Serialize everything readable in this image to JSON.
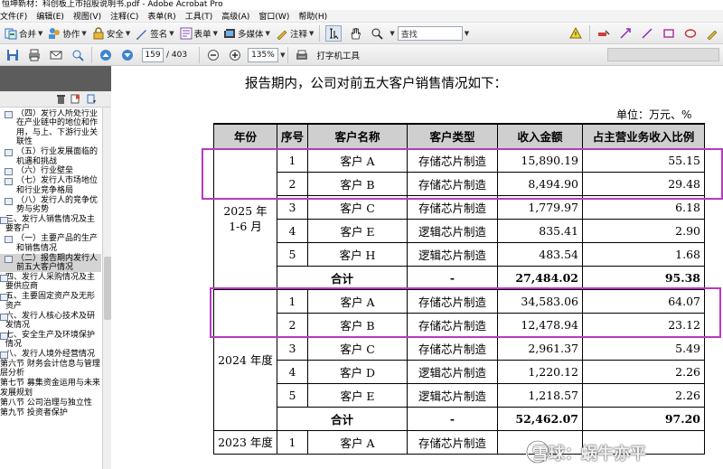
{
  "window": {
    "title": "恒坤新材：科创板上市招股说明书.pdf - Adobe Acrobat Pro"
  },
  "menu": [
    "文件(F)",
    "编辑(E)",
    "视图(V)",
    "注释(C)",
    "表单(R)",
    "工具(T)",
    "高级(A)",
    "窗口(W)",
    "帮助(H)"
  ],
  "toolbar1": {
    "merge": "合并",
    "collaborate": "协作",
    "secure": "安全",
    "sign": "签名",
    "forms": "表单",
    "multimedia": "多媒体",
    "comment": "注释",
    "search_placeholder": "查找"
  },
  "toolbar2": {
    "page_current": "159",
    "page_total": "/ 403",
    "zoom": "135%",
    "typewriter": "打字机工具"
  },
  "bookmarks": [
    {
      "label": "（四）发行人所处行业在产业链中的地位和作用，与上、下游行业关联性",
      "indent": 1
    },
    {
      "label": "（五）行业发展面临的机遇和挑战",
      "indent": 1
    },
    {
      "label": "（六）行业壁垒",
      "indent": 1
    },
    {
      "label": "（七）发行人市场地位和行业竞争格局",
      "indent": 1
    },
    {
      "label": "（八）发行人的竞争优势与劣势",
      "indent": 1
    },
    {
      "label": "三、发行人销售情况及主要客户",
      "indent": 0
    },
    {
      "label": "（一）主要产品的生产和销售情况",
      "indent": 1
    },
    {
      "label": "（二）报告期内发行人前五大客户情况",
      "indent": 1,
      "selected": true
    },
    {
      "label": "四、发行人采购情况及主要供应商",
      "indent": 0
    },
    {
      "label": "五、主要固定资产及无形资产",
      "indent": 0
    },
    {
      "label": "六、发行人核心技术及研发情况",
      "indent": 0
    },
    {
      "label": "七、安全生产及环境保护情况",
      "indent": 0
    },
    {
      "label": "八、发行人境外经营情况",
      "indent": 0
    },
    {
      "label": "第六节 财务会计信息与管理层分析",
      "indent": -1
    },
    {
      "label": "第七节 募集资金运用与未来发展规划",
      "indent": -1
    },
    {
      "label": "第八节 公司治理与独立性",
      "indent": -1
    },
    {
      "label": "第九节 投资者保护",
      "indent": -1
    }
  ],
  "doc": {
    "intro": "报告期内，公司对前五大客户销售情况如下：",
    "unit": "单位：万元、%",
    "headers": [
      "年份",
      "序号",
      "客户名称",
      "客户类型",
      "收入金额",
      "占主营业务收入比例"
    ],
    "groups": [
      {
        "year": "2025 年 1-6 月",
        "rows": [
          [
            "1",
            "客户 A",
            "存储芯片制造",
            "15,890.19",
            "55.15"
          ],
          [
            "2",
            "客户 B",
            "存储芯片制造",
            "8,494.90",
            "29.48"
          ],
          [
            "3",
            "客户 C",
            "存储芯片制造",
            "1,779.97",
            "6.18"
          ],
          [
            "4",
            "客户 E",
            "逻辑芯片制造",
            "835.41",
            "2.90"
          ],
          [
            "5",
            "客户 H",
            "逻辑芯片制造",
            "483.54",
            "1.68"
          ]
        ],
        "total": [
          "合计",
          "-",
          "27,484.02",
          "95.38"
        ]
      },
      {
        "year": "2024 年度",
        "rows": [
          [
            "1",
            "客户 A",
            "存储芯片制造",
            "34,583.06",
            "64.07"
          ],
          [
            "2",
            "客户 B",
            "存储芯片制造",
            "12,478.94",
            "23.12"
          ],
          [
            "3",
            "客户 C",
            "存储芯片制造",
            "2,961.37",
            "5.49"
          ],
          [
            "4",
            "客户 D",
            "逻辑芯片制造",
            "1,220.12",
            "2.26"
          ],
          [
            "5",
            "客户 E",
            "逻辑芯片制造",
            "1,218.57",
            "2.26"
          ]
        ],
        "total": [
          "合计",
          "-",
          "52,462.07",
          "97.20"
        ]
      },
      {
        "year": "2023 年度",
        "rows": [
          [
            "1",
            "客户 A",
            "存储芯片制造",
            "",
            ""
          ]
        ]
      }
    ]
  },
  "watermark": "雪球：蜗牛亦平",
  "colors": {
    "highlight": "#b53bbf",
    "header_bg": "#cfcfcf"
  }
}
